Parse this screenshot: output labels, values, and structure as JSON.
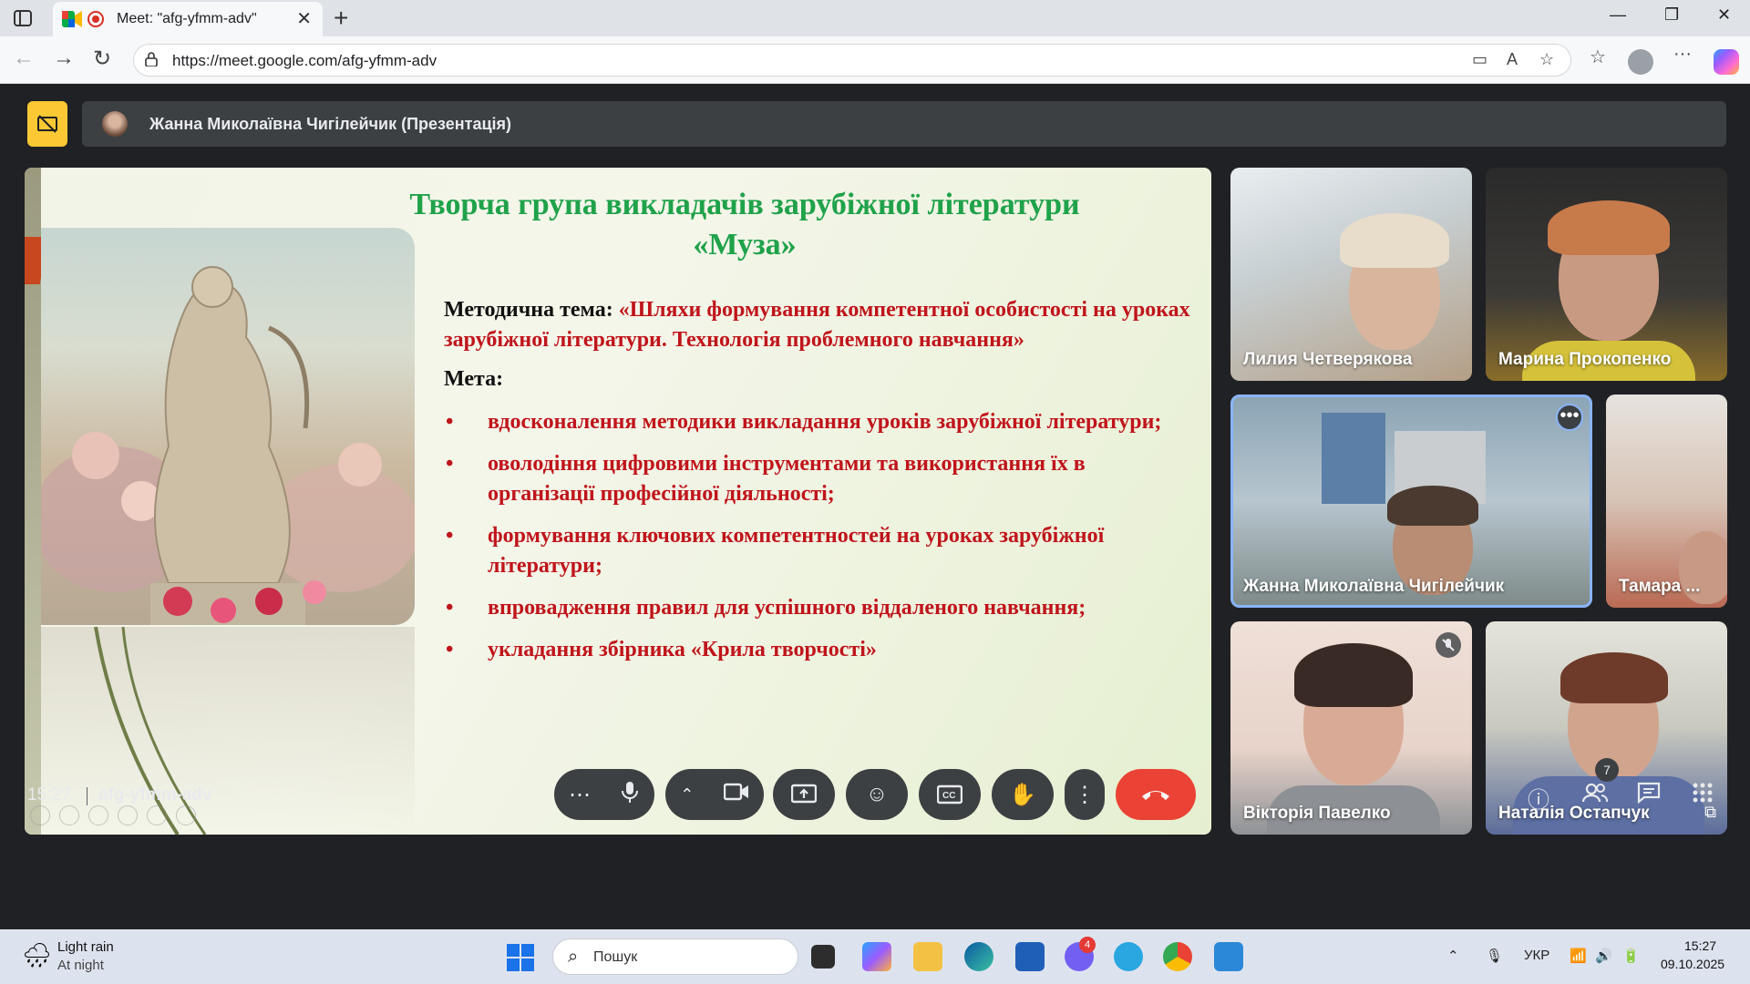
{
  "browser": {
    "tab_title": "Meet: \"afg-yfmm-adv\"",
    "url": "https://meet.google.com/afg-yfmm-adv"
  },
  "meet": {
    "presenter_title": "Жанна Миколаївна Чигілейчик (Презентація)",
    "meeting_code": "afg-yfmm-adv",
    "clock": "15:27",
    "people_count": "7"
  },
  "slide": {
    "title_line1": "Творча група викладачів зарубіжної літератури",
    "title_line2": "«Муза»",
    "theme_label": "Методична тема: ",
    "theme_text": "«Шляхи формування компетентної особистості на уроках зарубіжної літератури. Технологія проблемного навчання»",
    "goal_label": "Мета:",
    "goals": [
      "вдосконалення методики викладання уроків зарубіжної літератури;",
      "оволодіння цифровими інструментами та використання їх в організації професійної діяльності;",
      "формування ключових компетентностей на уроках зарубіжної літератури;",
      "впровадження правил для успішного віддаленого навчання;",
      "укладання збірника «Крила творчості»"
    ]
  },
  "participants": [
    {
      "name": "Лилия Четверякова"
    },
    {
      "name": "Марина Прокопенко"
    },
    {
      "name": "Жанна Миколаївна Чигілейчик"
    },
    {
      "name": "Тамара ..."
    },
    {
      "name": "Вікторія Павелко"
    },
    {
      "name": "Наталія Остапчук"
    }
  ],
  "taskbar": {
    "weather_title": "Light rain",
    "weather_sub": "At night",
    "search_placeholder": "Пошук",
    "language": "УКР",
    "time": "15:27",
    "date": "09.10.2025",
    "viber_badge": "4"
  },
  "colors": {
    "slide_title": "#1fa24a",
    "slide_red": "#c0141b",
    "hangup": "#ea4335",
    "presenting_badge": "#fcc934",
    "active_outline": "#8ab4f8"
  }
}
